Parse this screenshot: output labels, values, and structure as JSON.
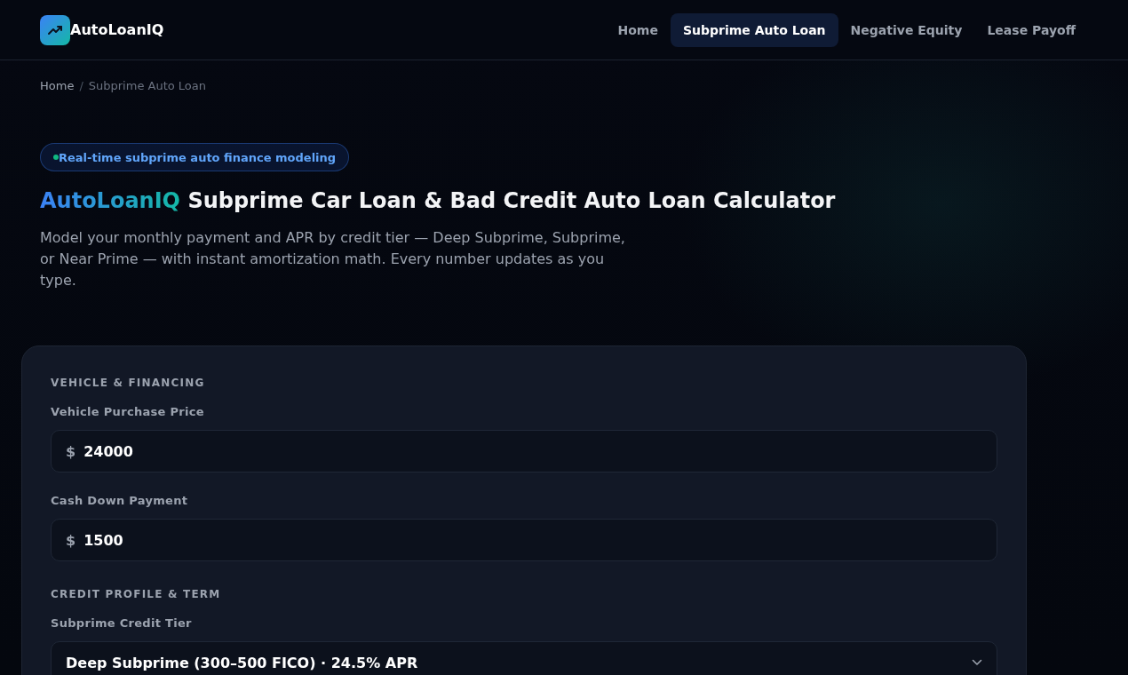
{
  "header": {
    "brand": "AutoLoanIQ",
    "nav": [
      {
        "label": "Home",
        "selected": false
      },
      {
        "label": "Subprime Auto Loan",
        "selected": true
      },
      {
        "label": "Negative Equity",
        "selected": false
      },
      {
        "label": "Lease Payoff",
        "selected": false
      }
    ]
  },
  "breadcrumb": {
    "separator": "/",
    "items": [
      {
        "label": "Home",
        "current": false
      },
      {
        "label": "Subprime Auto Loan",
        "current": true
      }
    ]
  },
  "hero": {
    "badge": "Real-time subprime auto finance modeling",
    "title_brand": "AutoLoanIQ",
    "title": "Subprime Car Loan & Bad Credit Auto Loan Calculator",
    "description": "Model your monthly payment and APR by credit tier — Deep Subprime, Subprime, or Near Prime — with instant amortization math. Every number updates as you type."
  },
  "calculator": {
    "sections": [
      {
        "heading": "VEHICLE & FINANCING",
        "fields": [
          {
            "kind": "currency",
            "label": "Vehicle Purchase Price",
            "prefix": "$",
            "value": "24000"
          },
          {
            "kind": "currency",
            "label": "Cash Down Payment",
            "prefix": "$",
            "value": "1500"
          }
        ]
      },
      {
        "heading": "CREDIT PROFILE & TERM",
        "fields": [
          {
            "kind": "select",
            "label": "Subprime Credit Tier",
            "value": "Deep Subprime (300–500 FICO) · 24.5% APR"
          }
        ]
      }
    ]
  }
}
